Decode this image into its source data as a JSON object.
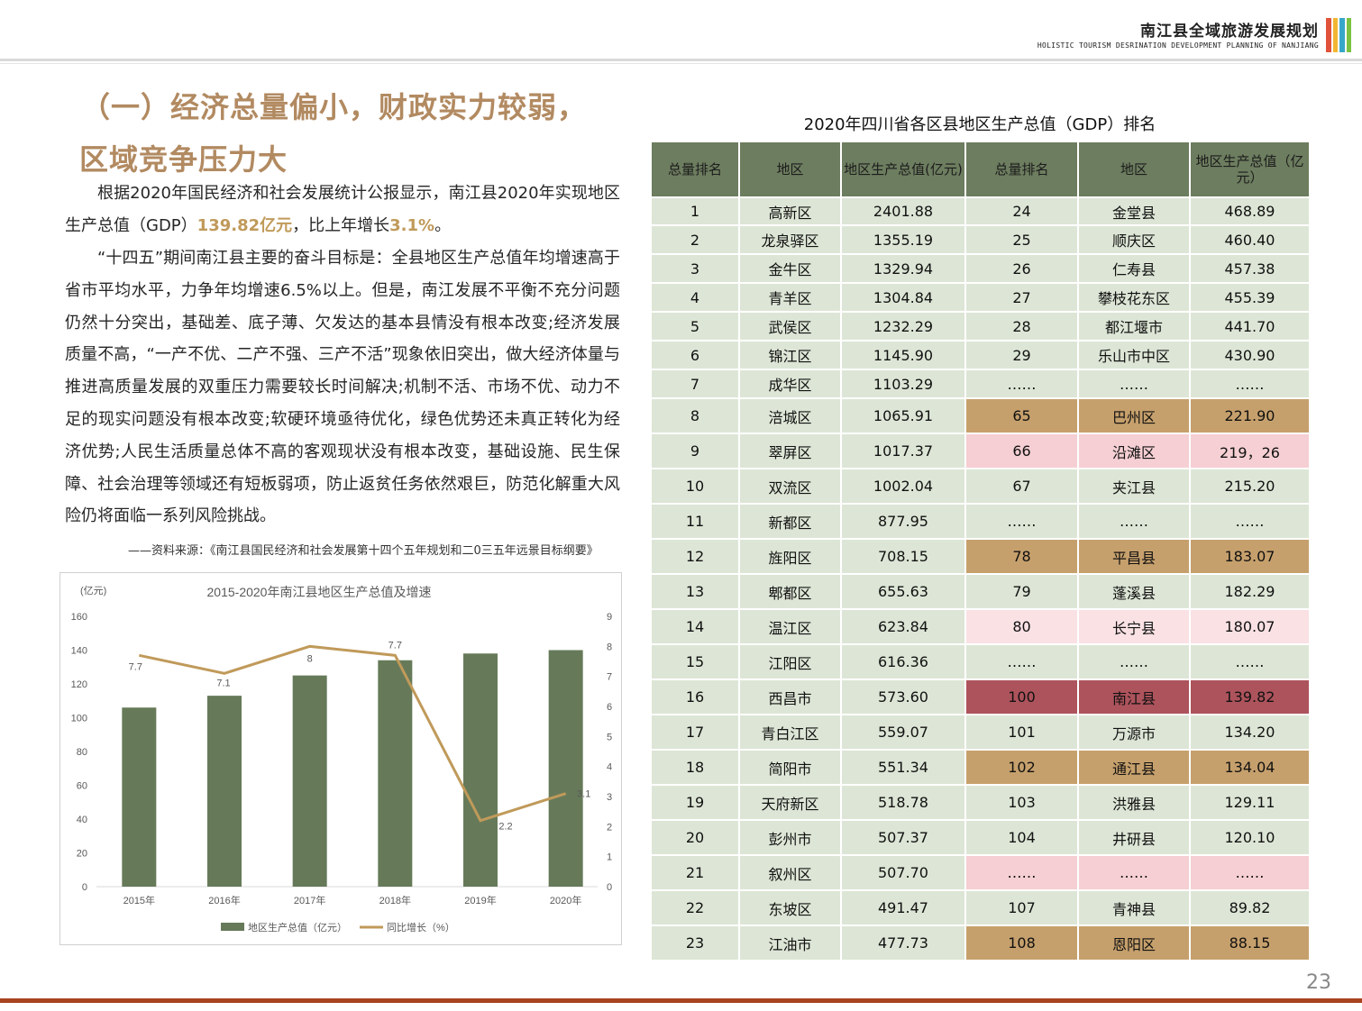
{
  "header": {
    "title": "南江县全域旅游发展规划",
    "subtitle": "HOLISTIC TOURISM DESRINATION DEVELOPMENT PLANNING OF NANJIANG",
    "bar_colors": [
      "#e0533a",
      "#f2b630",
      "#37a7c9",
      "#7cc242"
    ]
  },
  "heading": {
    "line1": "（一）经济总量偏小，财政实力较弱，",
    "line2": "区域竞争压力大"
  },
  "paragraph1": {
    "pre": "根据2020年国民经济和社会发展统计公报显示，南江县2020年实现地区生产总值（GDP）",
    "gdp": "139.82亿元",
    "mid": "，比上年增长",
    "growth": "3.1%",
    "post": "。"
  },
  "paragraph2": "“十四五”期间南江县主要的奋斗目标是：全县地区生产总值年均增速高于省市平均水平，力争年均增速6.5%以上。但是，南江发展不平衡不充分问题仍然十分突出，基础差、底子薄、欠发达的基本县情没有根本改变;经济发展质量不高，“一产不优、二产不强、三产不活”现象依旧突出，做大经济体量与推进高质量发展的双重压力需要较长时间解决;机制不活、市场不优、动力不足的现实问题没有根本改变;软硬环境亟待优化，绿色优势还未真正转化为经济优势;人民生活质量总体不高的客观现状没有根本改变，基础设施、民生保障、社会治理等领域还有短板弱项，防止返贫任务依然艰巨，防范化解重大风险仍将面临一系列风险挑战。",
  "source": "——资料来源：《南江县国民经济和社会发展第十四个五年规划和二0三五年远景目标纲要》",
  "chart_data": {
    "type": "bar",
    "title": "2015-2020年南江县地区生产总值及增速",
    "y_unit_label": "(亿元)",
    "categories": [
      "2015年",
      "2016年",
      "2017年",
      "2018年",
      "2019年",
      "2020年"
    ],
    "series": [
      {
        "name": "地区生产总值（亿元）",
        "type": "bar",
        "axis": "left",
        "color": "#667a59",
        "values": [
          106,
          113,
          125,
          134,
          138,
          140
        ]
      },
      {
        "name": "同比增长（%）",
        "type": "line",
        "axis": "right",
        "color": "#c09a5a",
        "values": [
          7.7,
          7.1,
          8,
          7.7,
          2.2,
          3.1
        ]
      }
    ],
    "line_labels": [
      "7.7",
      "7.1",
      "8",
      "7.7",
      "2.2",
      "3.1"
    ],
    "ylim_left": [
      0,
      160
    ],
    "yticks_left": [
      "0",
      "20",
      "40",
      "60",
      "80",
      "100",
      "120",
      "140",
      "160"
    ],
    "ylim_right": [
      0,
      9
    ],
    "yticks_right": [
      "0",
      "1",
      "2",
      "3",
      "4",
      "5",
      "6",
      "7",
      "8",
      "9"
    ],
    "legend_position": "bottom",
    "grid": false
  },
  "table": {
    "title": "2020年四川省各区县地区生产总值（GDP）排名",
    "headers": [
      "总量排名",
      "地区",
      "地区生产总值(亿元)",
      "总量排名",
      "地区",
      "地区生产总值（亿元）"
    ],
    "rows": [
      [
        "1",
        "高新区",
        "2401.88",
        "24",
        "金堂县",
        "468.89"
      ],
      [
        "2",
        "龙泉驿区",
        "1355.19",
        "25",
        "顺庆区",
        "460.40"
      ],
      [
        "3",
        "金牛区",
        "1329.94",
        "26",
        "仁寿县",
        "457.38"
      ],
      [
        "4",
        "青羊区",
        "1304.84",
        "27",
        "攀枝花东区",
        "455.39"
      ],
      [
        "5",
        "武侯区",
        "1232.29",
        "28",
        "都江堰市",
        "441.70"
      ],
      [
        "6",
        "锦江区",
        "1145.90",
        "29",
        "乐山市中区",
        "430.90"
      ],
      [
        "7",
        "成华区",
        "1103.29",
        "……",
        "……",
        "……"
      ],
      [
        "8",
        "涪城区",
        "1065.91",
        "65",
        "巴州区",
        "221.90"
      ],
      [
        "9",
        "翠屏区",
        "1017.37",
        "66",
        "沿滩区",
        "219，26"
      ],
      [
        "10",
        "双流区",
        "1002.04",
        "67",
        "夹江县",
        "215.20"
      ],
      [
        "11",
        "新都区",
        "877.95",
        "……",
        "……",
        "……"
      ],
      [
        "12",
        "旌阳区",
        "708.15",
        "78",
        "平昌县",
        "183.07"
      ],
      [
        "13",
        "郫都区",
        "655.63",
        "79",
        "蓬溪县",
        "182.29"
      ],
      [
        "14",
        "温江区",
        "623.84",
        "80",
        "长宁县",
        "180.07"
      ],
      [
        "15",
        "江阳区",
        "616.36",
        "……",
        "……",
        "……"
      ],
      [
        "16",
        "西昌市",
        "573.60",
        "100",
        "南江县",
        "139.82"
      ],
      [
        "17",
        "青白江区",
        "559.07",
        "101",
        "万源市",
        "134.20"
      ],
      [
        "18",
        "简阳市",
        "551.34",
        "102",
        "通江县",
        "134.04"
      ],
      [
        "19",
        "天府新区",
        "518.78",
        "103",
        "洪雅县",
        "129.11"
      ],
      [
        "20",
        "彭州市",
        "507.37",
        "104",
        "井研县",
        "120.10"
      ],
      [
        "21",
        "叙州区",
        "507.70",
        "……",
        "……",
        "……"
      ],
      [
        "22",
        "东坡区",
        "491.47",
        "107",
        "青神县",
        "89.82"
      ],
      [
        "23",
        "江油市",
        "477.73",
        "108",
        "恩阳区",
        "88.15"
      ]
    ],
    "highlight_colors": {
      "tan": "#c6a06c",
      "pink": "#f5cfd3",
      "light_pink": "#f9e1e4",
      "red": "#ad535c"
    },
    "row_highlights": [
      "",
      "",
      "",
      "",
      "",
      "",
      "",
      "tan",
      "pink",
      "",
      "",
      "tan",
      "",
      "light_pink",
      "",
      "red",
      "",
      "tan",
      "",
      "",
      "pink",
      "",
      "tan"
    ]
  },
  "page_number": "23"
}
